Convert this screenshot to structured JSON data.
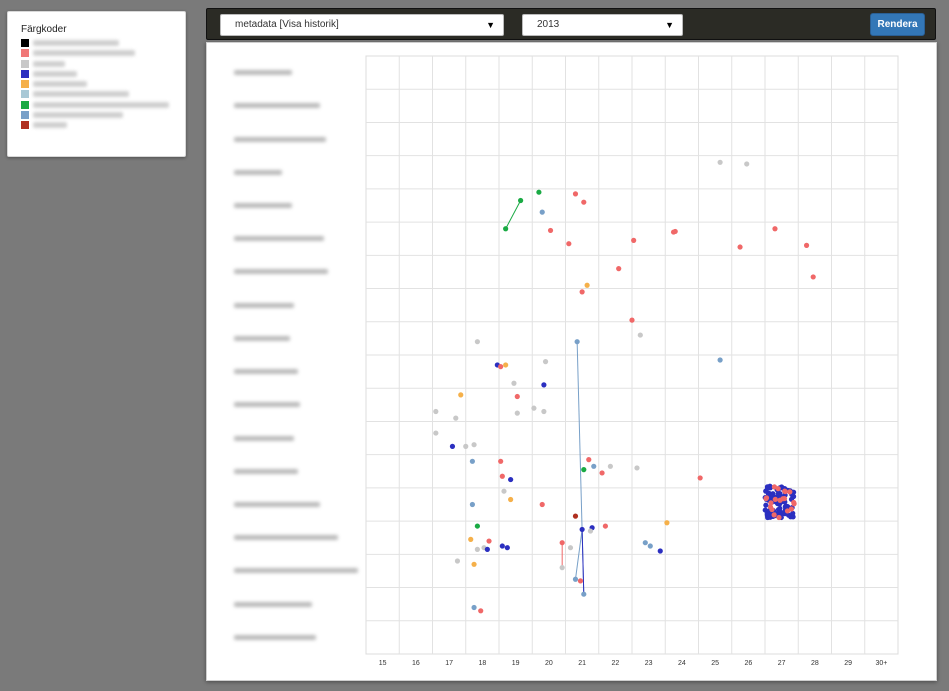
{
  "legend": {
    "title": "Färgkoder",
    "items": [
      {
        "color": "#000000"
      },
      {
        "color": "#f07878"
      },
      {
        "color": "#c8c8c8"
      },
      {
        "color": "#2b2fc0"
      },
      {
        "color": "#f5b04a"
      },
      {
        "color": "#a8c8d6"
      },
      {
        "color": "#1aaa44"
      },
      {
        "color": "#78a0c8"
      },
      {
        "color": "#b03020"
      }
    ]
  },
  "toolbar": {
    "source_select": "metadata [Visa historik]",
    "year_select": "2013",
    "render_label": "Rendera"
  },
  "chart_data": {
    "type": "scatter",
    "x_tick_labels": [
      "15",
      "16",
      "17",
      "18",
      "19",
      "20",
      "21",
      "22",
      "23",
      "24",
      "25",
      "26",
      "27",
      "28",
      "29",
      "30+"
    ],
    "xlim": [
      14.75,
      30.75
    ],
    "row_count": 18,
    "colors": {
      "red": "#f06868",
      "gray": "#c8c8c8",
      "blue": "#2b2fc0",
      "orange": "#f5b04a",
      "green": "#1aaa44",
      "steel": "#78a0c8",
      "darkred": "#b03020"
    },
    "points": [
      {
        "x": 25.4,
        "y": 3.2,
        "c": "gray"
      },
      {
        "x": 26.2,
        "y": 3.25,
        "c": "gray"
      },
      {
        "x": 19.95,
        "y": 4.1,
        "c": "green"
      },
      {
        "x": 21.05,
        "y": 4.15,
        "c": "red"
      },
      {
        "x": 21.3,
        "y": 4.4,
        "c": "red"
      },
      {
        "x": 19.4,
        "y": 4.35,
        "c": "green"
      },
      {
        "x": 20.05,
        "y": 4.7,
        "c": "steel"
      },
      {
        "x": 18.95,
        "y": 5.2,
        "c": "green"
      },
      {
        "x": 20.3,
        "y": 5.25,
        "c": "red"
      },
      {
        "x": 20.85,
        "y": 5.65,
        "c": "red"
      },
      {
        "x": 22.8,
        "y": 5.55,
        "c": "red"
      },
      {
        "x": 24.0,
        "y": 5.3,
        "c": "red"
      },
      {
        "x": 24.05,
        "y": 5.28,
        "c": "red"
      },
      {
        "x": 26.0,
        "y": 5.75,
        "c": "red"
      },
      {
        "x": 27.05,
        "y": 5.2,
        "c": "red"
      },
      {
        "x": 28.0,
        "y": 5.7,
        "c": "red"
      },
      {
        "x": 22.35,
        "y": 6.4,
        "c": "red"
      },
      {
        "x": 28.2,
        "y": 6.65,
        "c": "red"
      },
      {
        "x": 21.4,
        "y": 6.9,
        "c": "orange"
      },
      {
        "x": 21.25,
        "y": 7.1,
        "c": "red"
      },
      {
        "x": 22.75,
        "y": 7.95,
        "c": "red"
      },
      {
        "x": 23.0,
        "y": 8.4,
        "c": "gray"
      },
      {
        "x": 18.1,
        "y": 8.6,
        "c": "gray"
      },
      {
        "x": 21.1,
        "y": 8.6,
        "c": "steel"
      },
      {
        "x": 18.7,
        "y": 9.3,
        "c": "blue"
      },
      {
        "x": 18.8,
        "y": 9.35,
        "c": "red"
      },
      {
        "x": 18.95,
        "y": 9.3,
        "c": "orange"
      },
      {
        "x": 20.15,
        "y": 9.2,
        "c": "gray"
      },
      {
        "x": 25.4,
        "y": 9.15,
        "c": "steel"
      },
      {
        "x": 19.2,
        "y": 9.85,
        "c": "gray"
      },
      {
        "x": 20.1,
        "y": 9.9,
        "c": "blue"
      },
      {
        "x": 17.6,
        "y": 10.2,
        "c": "orange"
      },
      {
        "x": 19.3,
        "y": 10.25,
        "c": "red"
      },
      {
        "x": 16.85,
        "y": 10.7,
        "c": "gray"
      },
      {
        "x": 17.45,
        "y": 10.9,
        "c": "gray"
      },
      {
        "x": 19.3,
        "y": 10.75,
        "c": "gray"
      },
      {
        "x": 19.8,
        "y": 10.6,
        "c": "gray"
      },
      {
        "x": 20.1,
        "y": 10.7,
        "c": "gray"
      },
      {
        "x": 16.85,
        "y": 11.35,
        "c": "gray"
      },
      {
        "x": 17.35,
        "y": 11.75,
        "c": "blue"
      },
      {
        "x": 17.75,
        "y": 11.75,
        "c": "gray"
      },
      {
        "x": 18.0,
        "y": 11.7,
        "c": "gray"
      },
      {
        "x": 17.95,
        "y": 12.2,
        "c": "steel"
      },
      {
        "x": 18.8,
        "y": 12.2,
        "c": "red"
      },
      {
        "x": 21.45,
        "y": 12.15,
        "c": "red"
      },
      {
        "x": 21.6,
        "y": 12.35,
        "c": "steel"
      },
      {
        "x": 21.3,
        "y": 12.45,
        "c": "green"
      },
      {
        "x": 21.85,
        "y": 12.55,
        "c": "red"
      },
      {
        "x": 22.1,
        "y": 12.35,
        "c": "gray"
      },
      {
        "x": 22.9,
        "y": 12.4,
        "c": "gray"
      },
      {
        "x": 18.85,
        "y": 12.65,
        "c": "red"
      },
      {
        "x": 19.1,
        "y": 12.75,
        "c": "blue"
      },
      {
        "x": 24.8,
        "y": 12.7,
        "c": "red"
      },
      {
        "x": 18.9,
        "y": 13.1,
        "c": "gray"
      },
      {
        "x": 19.1,
        "y": 13.35,
        "c": "orange"
      },
      {
        "x": 17.95,
        "y": 13.5,
        "c": "steel"
      },
      {
        "x": 20.05,
        "y": 13.5,
        "c": "red"
      },
      {
        "x": 21.05,
        "y": 13.85,
        "c": "darkred"
      },
      {
        "x": 23.8,
        "y": 14.05,
        "c": "orange"
      },
      {
        "x": 18.1,
        "y": 14.15,
        "c": "green"
      },
      {
        "x": 21.25,
        "y": 14.25,
        "c": "blue"
      },
      {
        "x": 21.55,
        "y": 14.2,
        "c": "blue"
      },
      {
        "x": 21.5,
        "y": 14.3,
        "c": "gray"
      },
      {
        "x": 21.95,
        "y": 14.15,
        "c": "red"
      },
      {
        "x": 17.9,
        "y": 14.55,
        "c": "orange"
      },
      {
        "x": 18.45,
        "y": 14.6,
        "c": "red"
      },
      {
        "x": 18.1,
        "y": 14.85,
        "c": "gray"
      },
      {
        "x": 18.3,
        "y": 14.8,
        "c": "gray"
      },
      {
        "x": 18.4,
        "y": 14.85,
        "c": "blue"
      },
      {
        "x": 18.85,
        "y": 14.75,
        "c": "blue"
      },
      {
        "x": 19.0,
        "y": 14.8,
        "c": "blue"
      },
      {
        "x": 20.65,
        "y": 14.65,
        "c": "red"
      },
      {
        "x": 20.9,
        "y": 14.8,
        "c": "gray"
      },
      {
        "x": 23.15,
        "y": 14.65,
        "c": "steel"
      },
      {
        "x": 23.3,
        "y": 14.75,
        "c": "steel"
      },
      {
        "x": 23.6,
        "y": 14.9,
        "c": "blue"
      },
      {
        "x": 17.5,
        "y": 15.2,
        "c": "gray"
      },
      {
        "x": 18.0,
        "y": 15.3,
        "c": "orange"
      },
      {
        "x": 20.65,
        "y": 15.4,
        "c": "gray"
      },
      {
        "x": 21.05,
        "y": 15.75,
        "c": "steel"
      },
      {
        "x": 21.2,
        "y": 15.8,
        "c": "red"
      },
      {
        "x": 21.3,
        "y": 16.2,
        "c": "steel"
      },
      {
        "x": 18.0,
        "y": 16.6,
        "c": "steel"
      },
      {
        "x": 18.2,
        "y": 16.7,
        "c": "red"
      }
    ],
    "links": [
      {
        "from": [
          18.95,
          5.2
        ],
        "to": [
          19.4,
          4.35
        ],
        "c": "green"
      },
      {
        "from": [
          21.1,
          8.6
        ],
        "to": [
          21.3,
          16.2
        ],
        "c": "steel"
      },
      {
        "from": [
          21.05,
          15.75
        ],
        "to": [
          21.25,
          14.25
        ],
        "c": "steel"
      },
      {
        "from": [
          20.65,
          14.65
        ],
        "to": [
          20.65,
          15.4
        ],
        "c": "red"
      },
      {
        "from": [
          21.25,
          14.25
        ],
        "to": [
          21.3,
          16.2
        ],
        "c": "blue"
      }
    ],
    "cluster": {
      "x_min": 26.75,
      "x_max": 27.65,
      "y_min": 12.95,
      "y_max": 13.9,
      "blue_count": 90,
      "red_count": 20
    }
  }
}
